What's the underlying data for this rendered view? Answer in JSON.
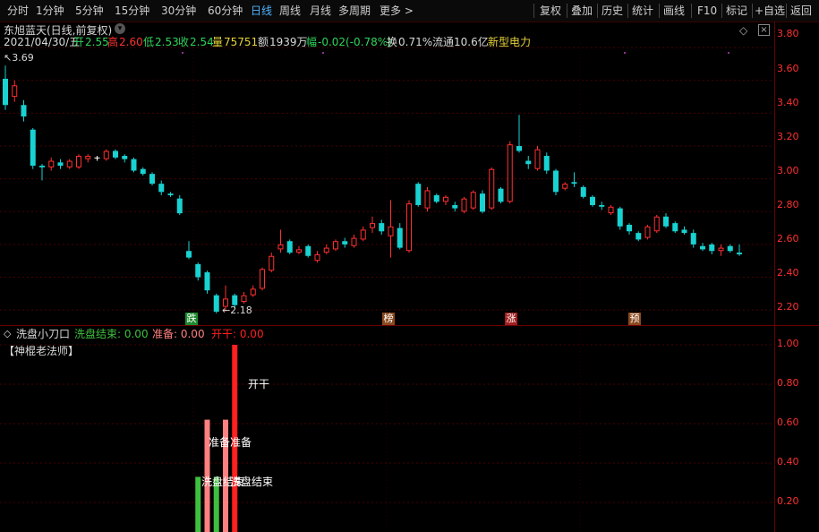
{
  "toolbar": {
    "periods": [
      "分时",
      "1分钟",
      "5分钟",
      "15分钟",
      "30分钟",
      "60分钟",
      "日线",
      "周线",
      "月线",
      "多周期",
      "更多 >"
    ],
    "active_period": "日线",
    "right_buttons": [
      "复权",
      "叠加",
      "历史",
      "统计",
      "画线",
      "F10",
      "标记",
      "+自选",
      "返回"
    ]
  },
  "stock": {
    "name_line": "东旭蓝天(日线,前复权)",
    "date": "2021/04/30/五",
    "open_label": "开",
    "open": "2.55",
    "high_label": "高",
    "high": "2.60",
    "low_label": "低",
    "low": "2.53",
    "close_label": "收",
    "close": "2.54",
    "volume_label": "量",
    "volume": "75751",
    "amount_label": "额",
    "amount": "1939万",
    "change_label": "幅",
    "change": "-0.02(-0.78%)",
    "turnover_label": "换",
    "turnover": "0.71%",
    "float_label": "流通",
    "float": "10.6亿",
    "sector": "新型电力"
  },
  "annotations": {
    "max_label": "3.69",
    "min_label": "2.18"
  },
  "badges": [
    {
      "text": "跌",
      "color": "#1e8a2e"
    },
    {
      "text": "榜",
      "color": "#8a4a1e"
    },
    {
      "text": "涨",
      "color": "#a01e1e"
    },
    {
      "text": "预",
      "color": "#8a4a1e"
    }
  ],
  "indicator": {
    "name": "洗盘小刀口",
    "l1_label": "洗盘结束: 0.00",
    "l2_label": "准备: 0.00",
    "l3_label": "开干: 0.00",
    "subtitle": "【神棍老法师】",
    "bar_texts": {
      "kaigan": "开干",
      "zhunbei": "准备准备",
      "xipan": "洗盘结束"
    },
    "colors": {
      "l1": "#3fbf3f",
      "l2": "#ff8080",
      "l3": "#ff2020"
    }
  },
  "price_axis": [
    "3.80",
    "3.60",
    "3.40",
    "3.20",
    "3.00",
    "2.80",
    "2.60",
    "2.40",
    "2.20"
  ],
  "indicator_axis": [
    "1.00",
    "0.80",
    "0.60",
    "0.40",
    "0.20"
  ],
  "chart_data": {
    "type": "candlestick",
    "ylim": [
      2.13,
      3.85
    ],
    "candles": [
      [
        3.61,
        3.45,
        3.69,
        3.42
      ],
      [
        3.5,
        3.57,
        3.6,
        3.47
      ],
      [
        3.45,
        3.38,
        3.48,
        3.35
      ],
      [
        3.3,
        3.08,
        3.31,
        3.06
      ],
      [
        3.08,
        3.07,
        3.09,
        2.99
      ],
      [
        3.07,
        3.11,
        3.13,
        3.05
      ],
      [
        3.1,
        3.08,
        3.12,
        3.06
      ],
      [
        3.07,
        3.11,
        3.12,
        3.06
      ],
      [
        3.07,
        3.14,
        3.15,
        3.06
      ],
      [
        3.12,
        3.14,
        3.15,
        3.1
      ],
      [
        3.13,
        3.13,
        3.14,
        3.11
      ],
      [
        3.12,
        3.17,
        3.18,
        3.11
      ],
      [
        3.17,
        3.13,
        3.18,
        3.12
      ],
      [
        3.14,
        3.12,
        3.15,
        3.1
      ],
      [
        3.12,
        3.05,
        3.13,
        3.04
      ],
      [
        3.06,
        3.03,
        3.07,
        3.02
      ],
      [
        3.03,
        2.97,
        3.04,
        2.96
      ],
      [
        2.97,
        2.92,
        2.99,
        2.9
      ],
      [
        2.91,
        2.9,
        2.92,
        2.89
      ],
      [
        2.88,
        2.79,
        2.9,
        2.78
      ],
      [
        2.56,
        2.52,
        2.62,
        2.51
      ],
      [
        2.48,
        2.4,
        2.49,
        2.38
      ],
      [
        2.43,
        2.32,
        2.44,
        2.3
      ],
      [
        2.29,
        2.19,
        2.3,
        2.18
      ],
      [
        2.22,
        2.27,
        2.35,
        2.19
      ],
      [
        2.29,
        2.23,
        2.3,
        2.21
      ],
      [
        2.25,
        2.29,
        2.31,
        2.24
      ],
      [
        2.29,
        2.33,
        2.35,
        2.28
      ],
      [
        2.33,
        2.45,
        2.46,
        2.32
      ],
      [
        2.44,
        2.53,
        2.55,
        2.43
      ],
      [
        2.57,
        2.6,
        2.69,
        2.55
      ],
      [
        2.62,
        2.55,
        2.63,
        2.54
      ],
      [
        2.55,
        2.57,
        2.59,
        2.54
      ],
      [
        2.59,
        2.53,
        2.6,
        2.52
      ],
      [
        2.5,
        2.54,
        2.56,
        2.49
      ],
      [
        2.55,
        2.58,
        2.6,
        2.54
      ],
      [
        2.57,
        2.62,
        2.63,
        2.56
      ],
      [
        2.62,
        2.6,
        2.64,
        2.58
      ],
      [
        2.59,
        2.64,
        2.66,
        2.58
      ],
      [
        2.63,
        2.69,
        2.71,
        2.62
      ],
      [
        2.7,
        2.73,
        2.77,
        2.67
      ],
      [
        2.73,
        2.68,
        2.75,
        2.66
      ],
      [
        2.65,
        2.71,
        2.87,
        2.52
      ],
      [
        2.7,
        2.58,
        2.73,
        2.57
      ],
      [
        2.56,
        2.85,
        2.87,
        2.55
      ],
      [
        2.97,
        2.84,
        2.98,
        2.83
      ],
      [
        2.82,
        2.93,
        2.95,
        2.8
      ],
      [
        2.9,
        2.86,
        2.91,
        2.85
      ],
      [
        2.86,
        2.89,
        2.9,
        2.84
      ],
      [
        2.84,
        2.82,
        2.86,
        2.8
      ],
      [
        2.8,
        2.88,
        2.89,
        2.79
      ],
      [
        2.82,
        2.92,
        2.93,
        2.81
      ],
      [
        2.91,
        2.8,
        2.93,
        2.79
      ],
      [
        2.82,
        3.06,
        3.07,
        2.81
      ],
      [
        2.94,
        2.86,
        2.95,
        2.85
      ],
      [
        2.86,
        3.21,
        3.23,
        2.85
      ],
      [
        3.2,
        3.17,
        3.39,
        3.16
      ],
      [
        3.11,
        3.09,
        3.14,
        3.06
      ],
      [
        3.06,
        3.18,
        3.2,
        3.05
      ],
      [
        3.14,
        3.05,
        3.16,
        3.03
      ],
      [
        3.05,
        2.92,
        3.06,
        2.9
      ],
      [
        2.94,
        2.97,
        2.98,
        2.93
      ],
      [
        2.98,
        2.97,
        3.04,
        2.95
      ],
      [
        2.95,
        2.89,
        2.96,
        2.88
      ],
      [
        2.89,
        2.84,
        2.9,
        2.83
      ],
      [
        2.84,
        2.83,
        2.86,
        2.81
      ],
      [
        2.79,
        2.83,
        2.84,
        2.78
      ],
      [
        2.82,
        2.71,
        2.83,
        2.69
      ],
      [
        2.72,
        2.68,
        2.73,
        2.66
      ],
      [
        2.67,
        2.63,
        2.68,
        2.62
      ],
      [
        2.64,
        2.71,
        2.72,
        2.63
      ],
      [
        2.68,
        2.77,
        2.78,
        2.67
      ],
      [
        2.77,
        2.71,
        2.79,
        2.7
      ],
      [
        2.73,
        2.68,
        2.74,
        2.67
      ],
      [
        2.69,
        2.67,
        2.71,
        2.66
      ],
      [
        2.67,
        2.6,
        2.69,
        2.58
      ],
      [
        2.59,
        2.57,
        2.61,
        2.56
      ],
      [
        2.6,
        2.56,
        2.61,
        2.54
      ],
      [
        2.56,
        2.58,
        2.6,
        2.53
      ],
      [
        2.59,
        2.56,
        2.6,
        2.55
      ],
      [
        2.55,
        2.54,
        2.6,
        2.53
      ]
    ],
    "indicator_bars": [
      {
        "series": "洗盘结束",
        "index": 20,
        "value": 0.33
      },
      {
        "series": "准备",
        "index": 21,
        "value": 0.62
      },
      {
        "series": "洗盘结束",
        "index": 22,
        "value": 0.33
      },
      {
        "series": "准备",
        "index": 23,
        "value": 0.62
      },
      {
        "series": "开干",
        "index": 24,
        "value": 1.0
      }
    ],
    "indicator_ylim": [
      0.05,
      1.05
    ]
  }
}
